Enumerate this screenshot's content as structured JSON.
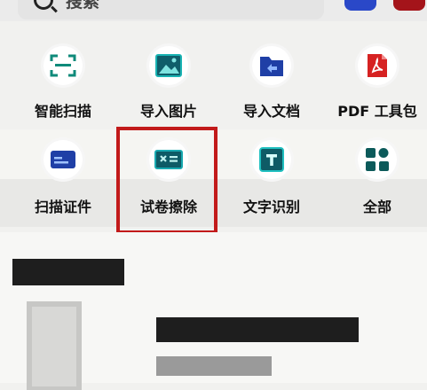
{
  "search": {
    "placeholder": "搜索",
    "icon": "search-icon"
  },
  "top_buttons": [
    {
      "icon": "blue-button-icon",
      "color": "#2a48c8"
    },
    {
      "icon": "red-button-icon",
      "color": "#a4141a"
    }
  ],
  "tools": [
    {
      "label": "智能扫描",
      "icon": "scan-icon"
    },
    {
      "label": "导入图片",
      "icon": "image-icon"
    },
    {
      "label": "导入文档",
      "icon": "import-document-icon"
    },
    {
      "label": "PDF 工具包",
      "icon": "pdf-icon"
    },
    {
      "label": "扫描证件",
      "icon": "id-card-icon"
    },
    {
      "label": "试卷擦除",
      "icon": "erase-paper-icon"
    },
    {
      "label": "文字识别",
      "icon": "text-recognition-icon"
    },
    {
      "label": "全部",
      "icon": "grid-all-icon"
    }
  ],
  "highlight": {
    "target": "试卷擦除",
    "color": "#c21a1a"
  }
}
